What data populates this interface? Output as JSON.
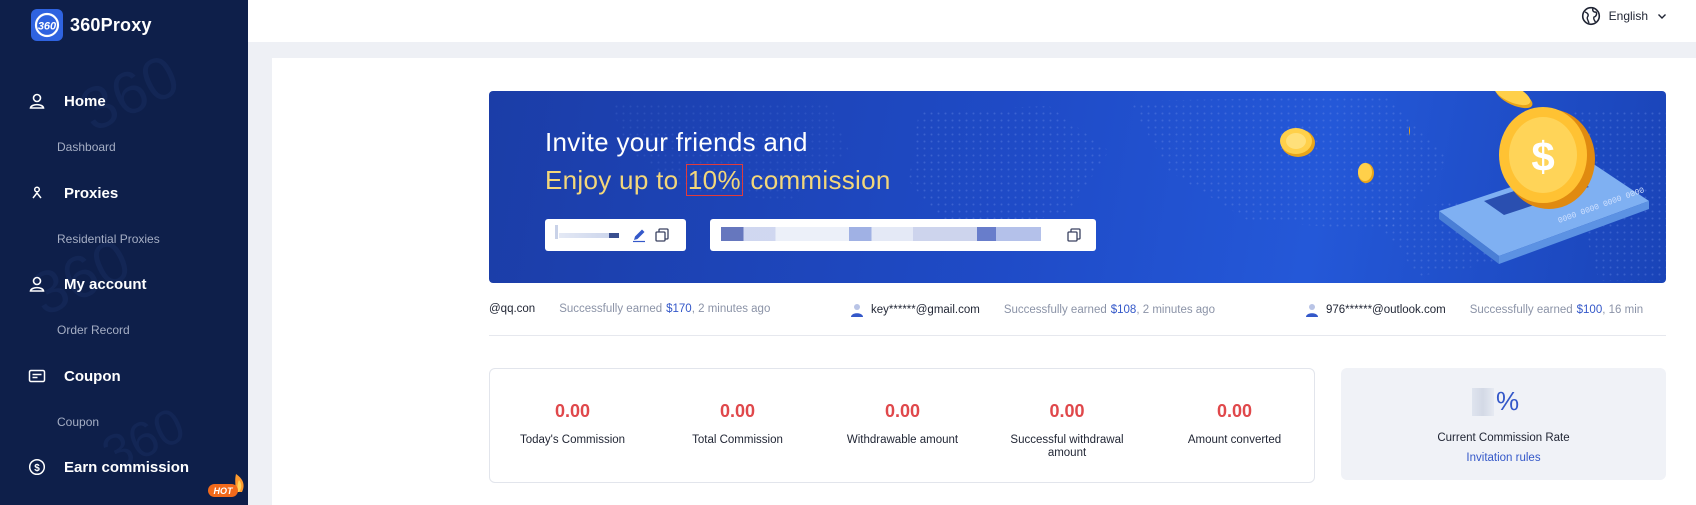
{
  "brand": {
    "name": "360Proxy",
    "logo_text": "360"
  },
  "sidebar": {
    "groups": [
      {
        "icon": "user-icon",
        "label": "Home",
        "sub": "Dashboard"
      },
      {
        "icon": "proxy-icon",
        "label": "Proxies",
        "sub": "Residential Proxies"
      },
      {
        "icon": "user-icon",
        "label": "My account",
        "sub": "Order Record"
      },
      {
        "icon": "coupon-icon",
        "label": "Coupon",
        "sub": "Coupon"
      },
      {
        "icon": "dollar-icon",
        "label": "Earn commission",
        "badge": "HOT"
      }
    ]
  },
  "header": {
    "language": "English",
    "language_icon": "globe-icon"
  },
  "banner": {
    "line1": "Invite your friends and",
    "line2_prefix": "Enjoy up to ",
    "line2_highlight": "10%",
    "line2_suffix": " commission",
    "colors": {
      "title": "#ffffff",
      "accent": "#f3d77a",
      "highlight_border": "#e23b3b"
    }
  },
  "ticker": [
    {
      "email": "@qq.con",
      "desc": "Successfully earned",
      "amount": "$170",
      "time": ", 2 minutes ago"
    },
    {
      "email": "key******@gmail.com",
      "desc": "Successfully earned",
      "amount": "$108",
      "time": ", 2 minutes ago"
    },
    {
      "email": "976******@outlook.com",
      "desc": "Successfully earned",
      "amount": "$100",
      "time": ", 16 min"
    }
  ],
  "stats": [
    {
      "value": "0.00",
      "label": "Today's Commission"
    },
    {
      "value": "0.00",
      "label": "Total Commission"
    },
    {
      "value": "0.00",
      "label": "Withdrawable amount"
    },
    {
      "value": "0.00",
      "label": "Successful withdrawal amount"
    },
    {
      "value": "0.00",
      "label": "Amount converted"
    }
  ],
  "rate": {
    "suffix": "%",
    "label": "Current Commission Rate",
    "link": "Invitation rules"
  },
  "colors": {
    "sidebar_bg": "#0e1f4a",
    "accent_blue": "#3458c9",
    "stat_red": "#e0484b"
  }
}
